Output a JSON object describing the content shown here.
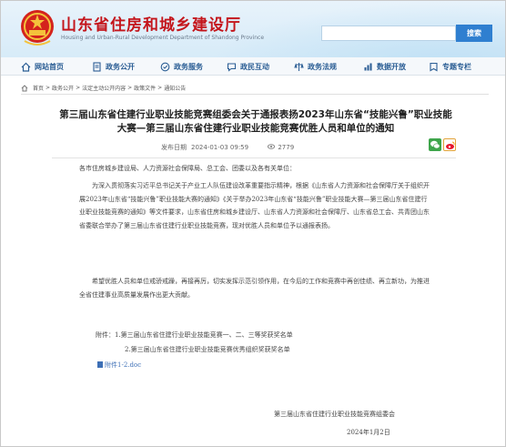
{
  "header": {
    "title": "山东省住房和城乡建设厅",
    "subtitle": "Housing and Urban-Rural Development Department of Shandong Province",
    "search_placeholder": "",
    "search_button": "搜索"
  },
  "nav": {
    "items": [
      {
        "label": "网站首页",
        "icon": "home-icon"
      },
      {
        "label": "政务公开",
        "icon": "document-icon"
      },
      {
        "label": "政务服务",
        "icon": "service-icon"
      },
      {
        "label": "政民互动",
        "icon": "chat-icon"
      },
      {
        "label": "政务法规",
        "icon": "law-icon"
      },
      {
        "label": "数据开放",
        "icon": "data-icon"
      },
      {
        "label": "专题专栏",
        "icon": "topic-icon"
      }
    ],
    "accent": "#2a5d94"
  },
  "breadcrumb": {
    "items": [
      "首页",
      "政务公开",
      "法定主动公开内容",
      "政策文件",
      "通知公告"
    ],
    "separator": ">"
  },
  "article": {
    "title": "第三届山东省住建行业职业技能竞赛组委会关于通报表扬2023年山东省“技能兴鲁”职业技能大赛—第三届山东省住建行业职业技能竞赛优胜人员和单位的通知",
    "date_label": "发布日期",
    "date": "2024-01-03 09:59",
    "views": "2779",
    "greeting": "各市住房城乡建设局、人力资源社会保障局、总工会、团委以及各有关单位：",
    "paragraph1": "为深入贯彻落实习近平总书记关于产业工人队伍建设改革重要指示精神，根据《山东省人力资源和社会保障厅关于组织开展2023年山东省“技能兴鲁”职业技能大赛的通知》《关于举办2023年山东省“技能兴鲁”职业技能大赛—第三届山东省住建行业职业技能竞赛的通知》等文件要求，山东省住房和城乡建设厅、山东省人力资源和社会保障厅、山东省总工会、共青团山东省委联合举办了第三届山东省住建行业职业技能竞赛，现对优胜人员和单位予以通报表扬。",
    "paragraph2": "希望优胜人员和单位戒骄戒躁，再接再厉，切实发挥示范引领作用，在今后的工作和竞赛中再创佳绩、再立新功，为推进全省住建事业高质量发展作出更大贡献。",
    "attachments": [
      "附件：1.第三届山东省住建行业职业技能竞赛一、二、三等奖获奖名单",
      "2.第三届山东省住建行业职业技能竞赛优秀组织奖获奖名单"
    ],
    "attachment_link": "附件1-2.doc",
    "signature": "第三届山东省住建行业职业技能竞赛组委会",
    "signature_date": "2024年1月2日"
  },
  "colors": {
    "brand_red": "#c4161c",
    "search_blue": "#2f7fd0",
    "link_blue": "#3d6fb6"
  }
}
